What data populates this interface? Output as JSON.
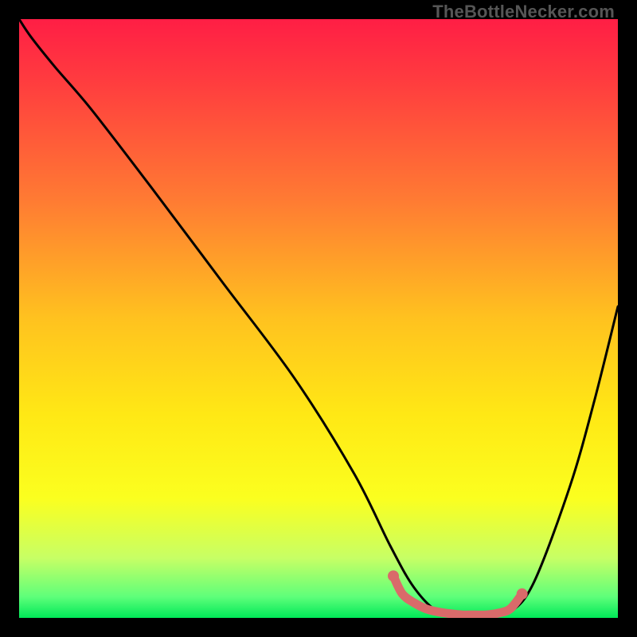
{
  "watermark": "TheBottleNecker.com",
  "chart_data": {
    "type": "line",
    "title": "",
    "xlabel": "",
    "ylabel": "",
    "xlim": [
      0,
      100
    ],
    "ylim": [
      0,
      100
    ],
    "grid": false,
    "gradient_stops": [
      {
        "offset": 0,
        "color": "#ff1e45"
      },
      {
        "offset": 0.1,
        "color": "#ff3b3f"
      },
      {
        "offset": 0.3,
        "color": "#ff7a33"
      },
      {
        "offset": 0.5,
        "color": "#ffc21f"
      },
      {
        "offset": 0.66,
        "color": "#ffe815"
      },
      {
        "offset": 0.8,
        "color": "#fbff1f"
      },
      {
        "offset": 0.9,
        "color": "#c7ff65"
      },
      {
        "offset": 0.965,
        "color": "#5eff7a"
      },
      {
        "offset": 1.0,
        "color": "#00e858"
      }
    ],
    "series": [
      {
        "name": "bottleneck-curve",
        "x": [
          0,
          2,
          6,
          12,
          22,
          34,
          46,
          56,
          62,
          66,
          70,
          74,
          78,
          82,
          86,
          92,
          96,
          100
        ],
        "y": [
          100,
          97,
          92,
          85,
          72,
          56,
          40,
          24,
          12,
          5,
          1,
          0.5,
          0.5,
          1,
          6,
          22,
          36,
          52
        ]
      }
    ],
    "highlight_segment": {
      "name": "sweet-spot",
      "color": "#d96a6a",
      "points_x": [
        62.5,
        64,
        66,
        68,
        70,
        72,
        74,
        76,
        78,
        80,
        82,
        84
      ],
      "points_y": [
        7.0,
        4.0,
        2.5,
        1.5,
        1.0,
        0.7,
        0.5,
        0.5,
        0.5,
        0.8,
        1.5,
        4.0
      ]
    }
  }
}
